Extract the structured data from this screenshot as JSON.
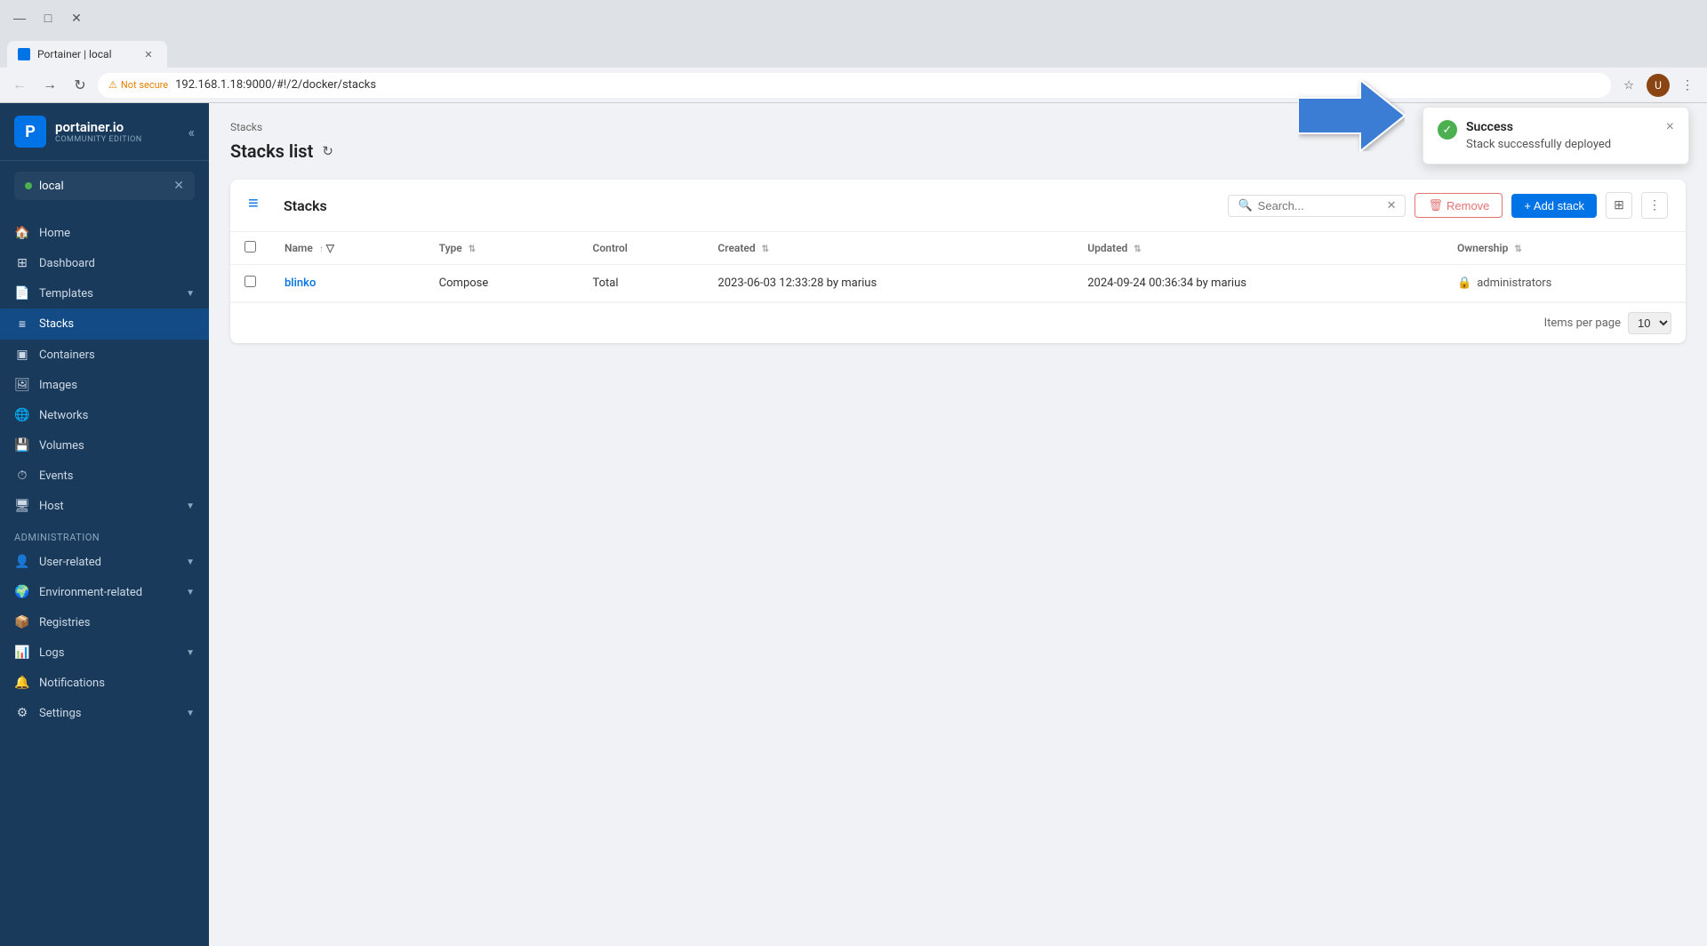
{
  "browser": {
    "tab_label": "Portainer | local",
    "url": "192.168.1.18:9000/#!/2/docker/stacks",
    "security_warning": "Not secure"
  },
  "sidebar": {
    "logo_main": "portainer.io",
    "logo_sub": "Community Edition",
    "endpoint_name": "local",
    "nav_items": [
      {
        "id": "home",
        "label": "Home",
        "icon": "🏠"
      },
      {
        "id": "dashboard",
        "label": "Dashboard",
        "icon": "⊞"
      },
      {
        "id": "templates",
        "label": "Templates",
        "icon": "📄",
        "has_chevron": true
      },
      {
        "id": "stacks",
        "label": "Stacks",
        "icon": "≡",
        "active": true
      },
      {
        "id": "containers",
        "label": "Containers",
        "icon": "▣"
      },
      {
        "id": "images",
        "label": "Images",
        "icon": "🖼"
      },
      {
        "id": "networks",
        "label": "Networks",
        "icon": "🌐"
      },
      {
        "id": "volumes",
        "label": "Volumes",
        "icon": "💾"
      },
      {
        "id": "events",
        "label": "Events",
        "icon": "⏱"
      },
      {
        "id": "host",
        "label": "Host",
        "icon": "🖥",
        "has_chevron": true
      }
    ],
    "admin_label": "Administration",
    "admin_items": [
      {
        "id": "user-related",
        "label": "User-related",
        "icon": "👤",
        "has_chevron": true
      },
      {
        "id": "environment-related",
        "label": "Environment-related",
        "icon": "🌍",
        "has_chevron": true
      },
      {
        "id": "registries",
        "label": "Registries",
        "icon": "📦"
      },
      {
        "id": "logs",
        "label": "Logs",
        "icon": "📊",
        "has_chevron": true
      },
      {
        "id": "notifications",
        "label": "Notifications",
        "icon": "🔔"
      },
      {
        "id": "settings",
        "label": "Settings",
        "icon": "⚙",
        "has_chevron": true
      }
    ]
  },
  "breadcrumb": "Stacks",
  "page_title": "Stacks list",
  "card": {
    "title": "Stacks",
    "search_placeholder": "Search...",
    "btn_remove": "Remove",
    "btn_add": "+ Add stack",
    "table_headers": [
      "Name",
      "Type",
      "Control",
      "Created",
      "Updated",
      "Ownership"
    ],
    "rows": [
      {
        "name": "blinko",
        "type": "Compose",
        "control": "Total",
        "created": "2023-06-03 12:33:28 by marius",
        "updated": "2024-09-24 00:36:34 by marius",
        "ownership_icon": "🔒",
        "ownership": "administrators"
      }
    ],
    "items_per_page_label": "Items per page",
    "items_per_page_value": "10"
  },
  "toast": {
    "title": "Success",
    "message": "Stack successfully deployed",
    "close_label": "×"
  }
}
